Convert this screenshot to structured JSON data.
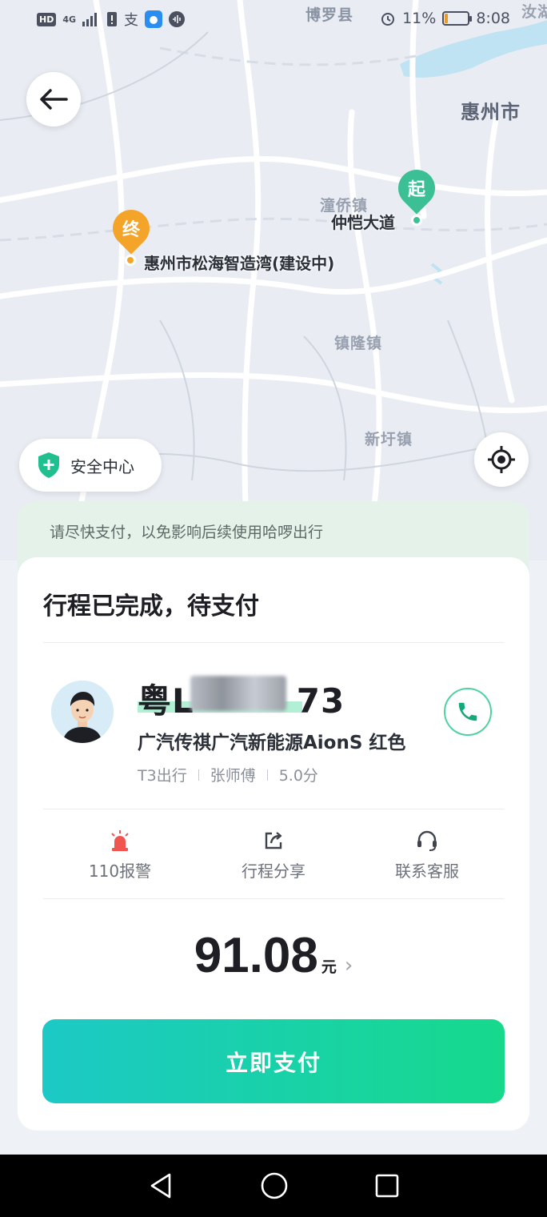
{
  "status_bar": {
    "left_chips": [
      "HD",
      "4G"
    ],
    "battery_percent": "11%",
    "time": "8:08"
  },
  "map": {
    "labels": {
      "boluo": "博罗县",
      "huizhou": "惠州市",
      "tongqiao": "潼侨镇",
      "zhenlong": "镇隆镇",
      "xinxu": "新圩镇",
      "corner": "汝湖"
    },
    "start_pin": "起",
    "start_place": "仲恺大道",
    "end_pin": "终",
    "end_place": "惠州市松海智造湾(建设中)"
  },
  "safety_center": {
    "label": "安全中心"
  },
  "notice": "请尽快支付，以免影响后续使用哈啰出行",
  "card": {
    "title": "行程已完成，待支付",
    "plate_prefix": "粤L",
    "plate_suffix": "73",
    "car_desc": "广汽传祺广汽新能源AionS  红色",
    "company": "T3出行",
    "driver": "张师傅",
    "rating": "5.0分",
    "actions": [
      {
        "label": "110报警",
        "icon": "alarm-icon"
      },
      {
        "label": "行程分享",
        "icon": "share-icon"
      },
      {
        "label": "联系客服",
        "icon": "headset-icon"
      }
    ],
    "amount": "91.08",
    "amount_unit": "元",
    "pay_label": "立即支付"
  },
  "colors": {
    "accent_green": "#16d98c",
    "accent_teal": "#1cc9c6",
    "start_pin": "#3cbf94",
    "end_pin": "#f5a42a",
    "alarm_red": "#f0564f"
  }
}
